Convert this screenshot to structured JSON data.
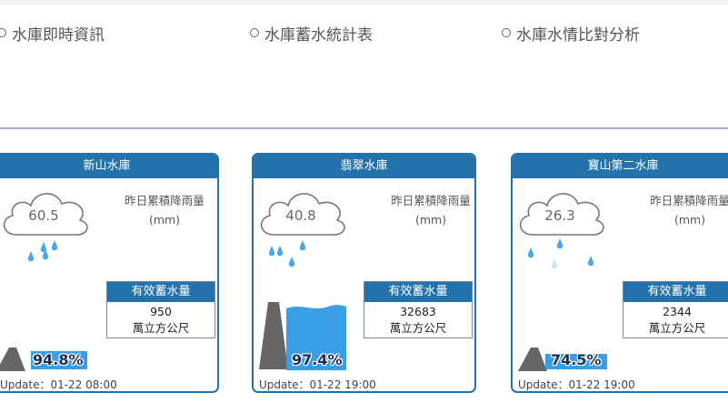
{
  "tabs": [
    {
      "label": "水庫即時資訊"
    },
    {
      "label": "水庫蓄水統計表"
    },
    {
      "label": "水庫水情比對分析"
    }
  ],
  "cards": [
    {
      "name": "新山水庫",
      "rainfall": "60.5",
      "rain_label": "昨日累積降雨量",
      "rain_unit": "(mm)",
      "storage_title": "有效蓄水量",
      "storage_value": "950",
      "storage_unit": "萬立方公尺",
      "percent": "94.8%",
      "percent_value": 0.948,
      "update": "Update：01-22 08:00"
    },
    {
      "name": "翡翠水庫",
      "rainfall": "40.8",
      "rain_label": "昨日累積降雨量",
      "rain_unit": "(mm)",
      "storage_title": "有效蓄水量",
      "storage_value": "32683",
      "storage_unit": "萬立方公尺",
      "percent": "97.4%",
      "percent_value": 0.974,
      "update": "Update：01-22 19:00"
    },
    {
      "name": "寶山第二水庫",
      "rainfall": "26.3",
      "rain_label": "昨日累積降雨量",
      "rain_unit": "(mm)",
      "storage_title": "有效蓄水量",
      "storage_value": "2344",
      "storage_unit": "萬立方公尺",
      "percent": "74.5%",
      "percent_value": 0.745,
      "update": "Update：01-22 19:00"
    }
  ],
  "colors": {
    "header": "#2472ac",
    "water": "#3a9ee6",
    "raindrop": "#4aa8e8"
  },
  "icons": [
    "cloud-icon",
    "raindrop-icon",
    "dam-icon",
    "radio-icon"
  ]
}
